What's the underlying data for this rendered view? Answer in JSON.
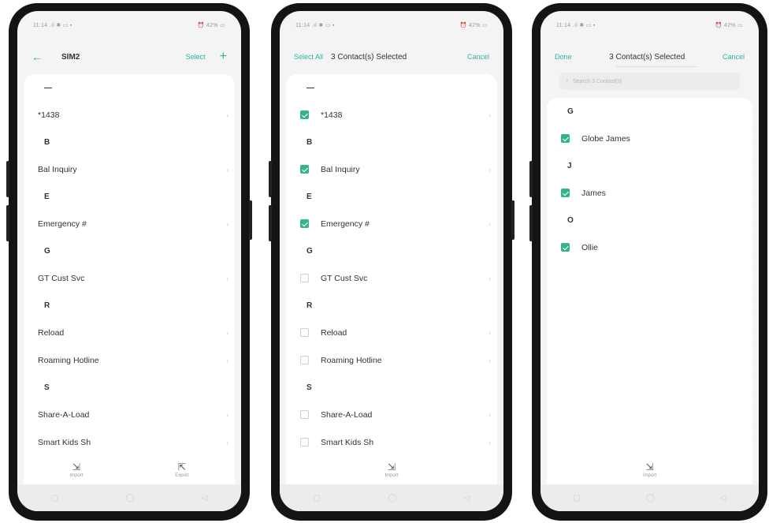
{
  "colors": {
    "accent": "#2bb5a0",
    "checkbox_checked": "#34b48e",
    "phone_frame": "#141414",
    "screen_bg": "#f4f4f4"
  },
  "status_bar": {
    "left": "11:14  .ıl  ✱  ▭  ▪",
    "right": "⏰ 42% ▭"
  },
  "nav_bar": {
    "recents": "▢",
    "home": "◯",
    "back": "◁"
  },
  "phone1": {
    "back_icon": "←",
    "title": "SIM2",
    "select_label": "Select",
    "add_icon": "+",
    "list": [
      {
        "type": "header",
        "text": "—"
      },
      {
        "type": "item",
        "text": "*1438"
      },
      {
        "type": "header",
        "text": "B"
      },
      {
        "type": "item",
        "text": "Bal Inquiry"
      },
      {
        "type": "header",
        "text": "E"
      },
      {
        "type": "item",
        "text": "Emergency #"
      },
      {
        "type": "header",
        "text": "G"
      },
      {
        "type": "item",
        "text": "GT Cust Svc"
      },
      {
        "type": "header",
        "text": "R"
      },
      {
        "type": "item",
        "text": "Reload"
      },
      {
        "type": "item",
        "text": "Roaming Hotline"
      },
      {
        "type": "header",
        "text": "S"
      },
      {
        "type": "item",
        "text": "Share-A-Load"
      },
      {
        "type": "item",
        "text": "Smart Kids Sh"
      }
    ],
    "actions": [
      {
        "icon": "⇲",
        "label": "Import"
      },
      {
        "icon": "⇱",
        "label": "Export"
      }
    ]
  },
  "phone2": {
    "select_all": "Select All",
    "title": "3 Contact(s) Selected",
    "cancel": "Cancel",
    "list": [
      {
        "type": "header",
        "text": "—"
      },
      {
        "type": "item",
        "text": "*1438",
        "checked": true
      },
      {
        "type": "header",
        "text": "B"
      },
      {
        "type": "item",
        "text": "Bal Inquiry",
        "checked": true
      },
      {
        "type": "header",
        "text": "E"
      },
      {
        "type": "item",
        "text": "Emergency #",
        "checked": true
      },
      {
        "type": "header",
        "text": "G"
      },
      {
        "type": "item",
        "text": "GT Cust Svc",
        "checked": false
      },
      {
        "type": "header",
        "text": "R"
      },
      {
        "type": "item",
        "text": "Reload",
        "checked": false
      },
      {
        "type": "item",
        "text": "Roaming Hotline",
        "checked": false
      },
      {
        "type": "header",
        "text": "S"
      },
      {
        "type": "item",
        "text": "Share-A-Load",
        "checked": false
      },
      {
        "type": "item",
        "text": "Smart Kids Sh",
        "checked": false
      }
    ],
    "actions": [
      {
        "icon": "⇲",
        "label": "Import"
      }
    ]
  },
  "phone3": {
    "done": "Done",
    "title": "3 Contact(s) Selected",
    "cancel": "Cancel",
    "search_placeholder": "Search 3 Contact(s)",
    "list": [
      {
        "type": "header",
        "text": "G"
      },
      {
        "type": "item",
        "text": "Globe James",
        "checked": true
      },
      {
        "type": "header",
        "text": "J"
      },
      {
        "type": "item",
        "text": "James",
        "checked": true
      },
      {
        "type": "header",
        "text": "O"
      },
      {
        "type": "item",
        "text": "Ollie",
        "checked": true
      }
    ],
    "actions": [
      {
        "icon": "⇲",
        "label": "Import"
      }
    ]
  }
}
